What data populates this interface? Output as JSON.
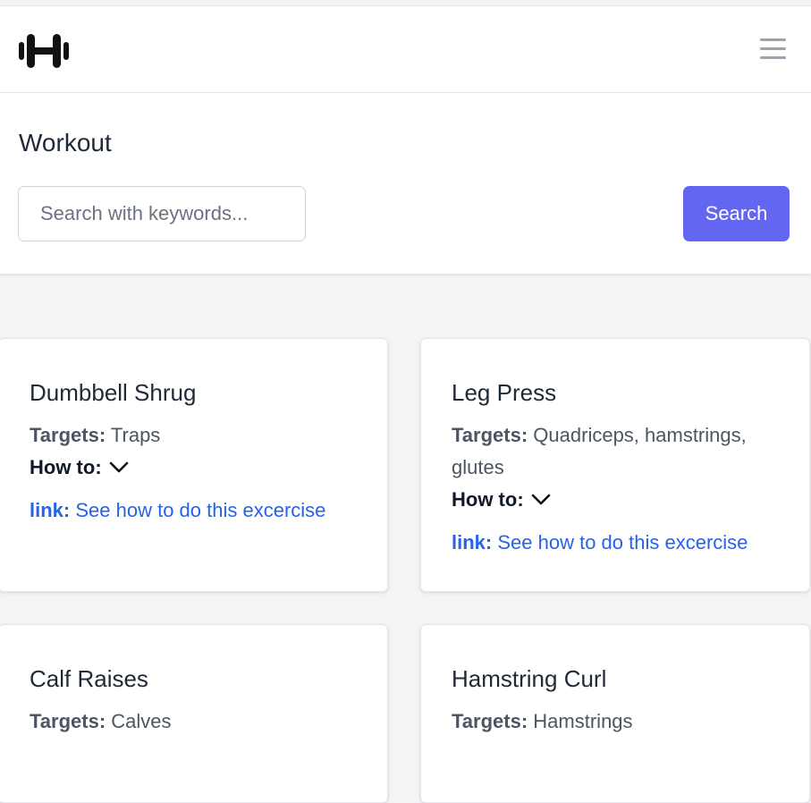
{
  "navbar": {
    "logo_icon": "dumbbell-logo-icon",
    "menu_icon": "hamburger-menu-icon"
  },
  "page": {
    "title": "Workout"
  },
  "search": {
    "placeholder": "Search with keywords...",
    "value": "",
    "button_label": "Search"
  },
  "colors": {
    "accent": "#6366f1",
    "link": "#2563eb",
    "background": "#f3f4f6"
  },
  "labels": {
    "targets": "Targets:",
    "howto": "How to:",
    "link": "link:",
    "link_text": "See how to do this excercise"
  },
  "exercises": [
    {
      "name": "Dumbbell Shrug",
      "targets": "Traps"
    },
    {
      "name": "Leg Press",
      "targets": "Quadriceps, hamstrings, glutes"
    },
    {
      "name": "Calf Raises",
      "targets": "Calves"
    },
    {
      "name": "Hamstring Curl",
      "targets": "Hamstrings"
    }
  ]
}
